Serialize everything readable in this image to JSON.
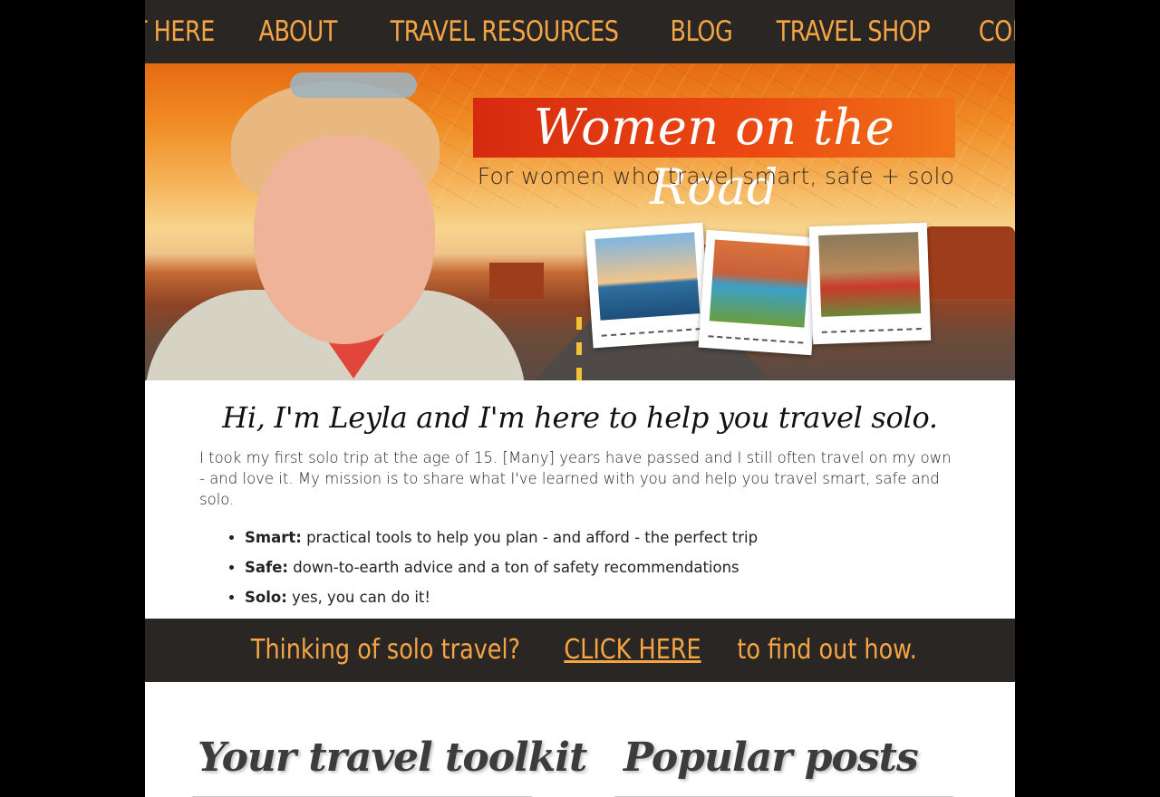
{
  "nav": {
    "items": [
      "START HERE",
      "ABOUT",
      "TRAVEL RESOURCES",
      "BLOG",
      "TRAVEL SHOP",
      "CONTACT"
    ]
  },
  "hero": {
    "title": "Women on the Road",
    "tagline": "For women who travel smart, safe + solo"
  },
  "intro": {
    "heading": "Hi, I'm Leyla and I'm here to help you travel solo.",
    "paragraph": "I took my first solo trip at the age of 15. [Many] years have passed and I still often travel on my own - and love it. My mission is to share what I've learned with you and help you travel smart, safe and solo.",
    "bullets": [
      {
        "label": "Smart:",
        "text": " practical tools to help you plan - and afford - the perfect trip"
      },
      {
        "label": "Safe:",
        "text": " down-to-earth advice and a ton of safety recommendations"
      },
      {
        "label": "Solo:",
        "text": " yes, you can do it!"
      }
    ]
  },
  "cta": {
    "before": "Thinking of solo travel? ",
    "link": "CLICK HERE",
    "after": " to find out how."
  },
  "sections": {
    "toolkit": "Your travel toolkit",
    "popular": "Popular posts"
  },
  "colors": {
    "accent": "#f5a544",
    "dark_bar": "#2a2624",
    "title_red": "#e03a12"
  }
}
